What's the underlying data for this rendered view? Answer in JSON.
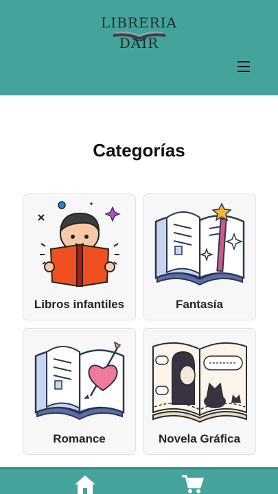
{
  "header": {
    "logo_text": "LIBRERIA DAIR",
    "logo_icon": "open-book-logo",
    "menu_icon": "hamburger-icon"
  },
  "page": {
    "title": "Categorías"
  },
  "categories": [
    {
      "label": "Libros infantiles",
      "icon": "child-reading-book"
    },
    {
      "label": "Fantasía",
      "icon": "magic-wand-book"
    },
    {
      "label": "Romance",
      "icon": "heart-arrow-book"
    },
    {
      "label": "Novela Gráfica",
      "icon": "comic-book"
    }
  ],
  "bottom_nav": {
    "items": [
      {
        "icon": "home-icon"
      },
      {
        "icon": "cart-icon"
      }
    ]
  },
  "colors": {
    "primary": "#44a49c",
    "card_bg": "#f7f7f7"
  }
}
